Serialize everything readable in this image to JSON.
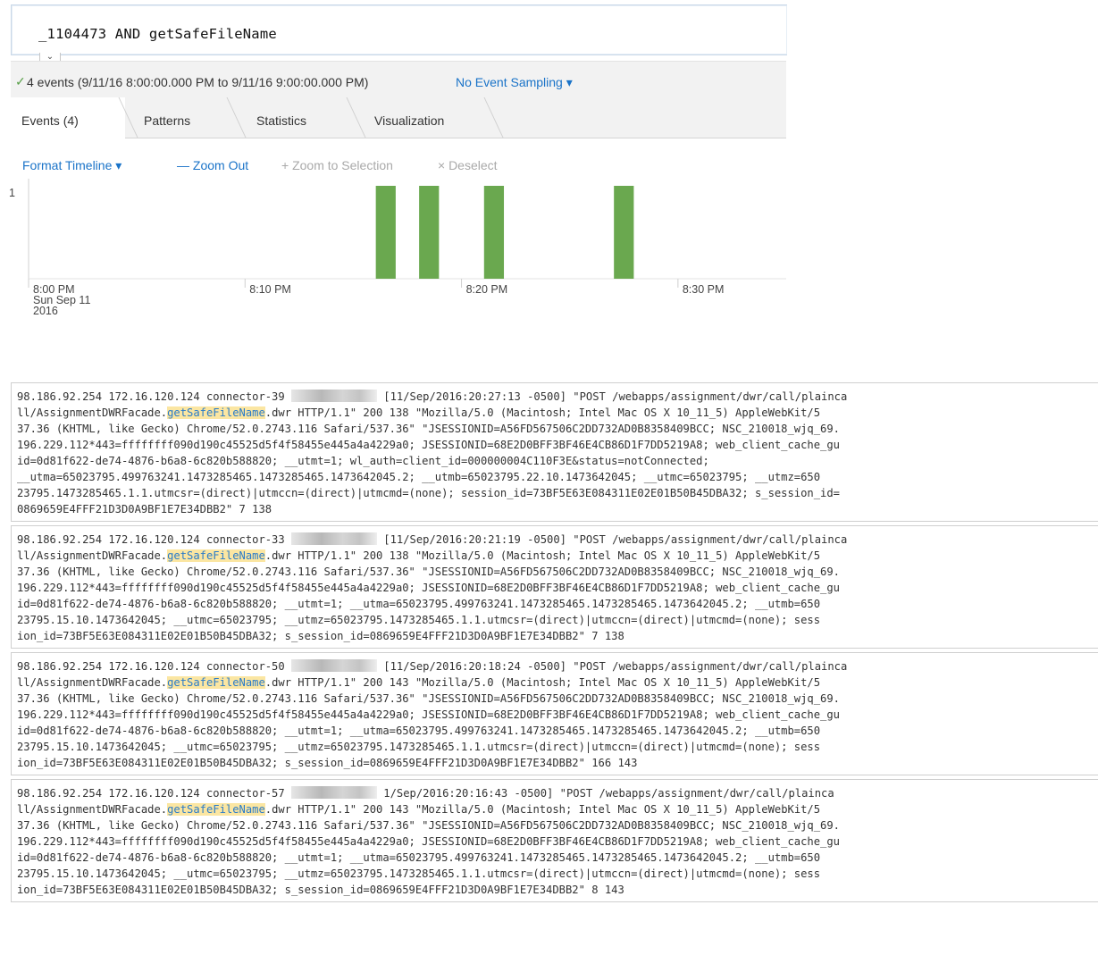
{
  "search": {
    "query": "_1104473 AND getSafeFileName"
  },
  "status": {
    "check_icon": "check-icon",
    "summary": "4 events (9/11/16 8:00:00.000 PM to 9/11/16 9:00:00.000 PM)",
    "sampling": "No Event Sampling ▾"
  },
  "tabs": [
    {
      "label": "Events (4)",
      "active": true
    },
    {
      "label": "Patterns",
      "active": false
    },
    {
      "label": "Statistics",
      "active": false
    },
    {
      "label": "Visualization",
      "active": false
    }
  ],
  "timeline_toolbar": {
    "format": "Format Timeline ▾",
    "zoom_out": "— Zoom Out",
    "zoom_selection": "+ Zoom to Selection",
    "deselect": "× Deselect"
  },
  "chart_data": {
    "type": "bar",
    "y_tick": "1",
    "ylim": [
      0,
      1
    ],
    "xlim_minutes": [
      0,
      35
    ],
    "x_ticks": [
      {
        "minute": 0,
        "line1": "8:00 PM",
        "line2": "Sun Sep 11",
        "line3": "2016"
      },
      {
        "minute": 10,
        "line1": "8:10 PM",
        "line2": "",
        "line3": ""
      },
      {
        "minute": 20,
        "line1": "8:20 PM",
        "line2": "",
        "line3": ""
      },
      {
        "minute": 30,
        "line1": "8:30 PM",
        "line2": "",
        "line3": ""
      }
    ],
    "bars": [
      {
        "minute": 16,
        "count": 1
      },
      {
        "minute": 18,
        "count": 1
      },
      {
        "minute": 21,
        "count": 1
      },
      {
        "minute": 27,
        "count": 1
      }
    ],
    "bar_color": "#6aa84f"
  },
  "events": [
    {
      "lines": [
        [
          "98.186.92.254 172.16.120.124 connector-39 ",
          "[BLUR]",
          " [11/Sep/2016:20:27:13 -0500] \"POST /webapps/assignment/dwr/call/plainca"
        ],
        [
          "ll/AssignmentDWRFacade.",
          "[HL]getSafeFileName",
          ".dwr HTTP/1.1\" 200 138 \"Mozilla/5.0 (Macintosh; Intel Mac OS X 10_11_5) AppleWebKit/5"
        ],
        [
          "37.36 (KHTML, like Gecko) Chrome/52.0.2743.116 Safari/537.36\" \"JSESSIONID=A56FD567506C2DD732AD0B8358409BCC; NSC_210018_wjq_69."
        ],
        [
          "196.229.112*443=ffffffff090d190c45525d5f4f58455e445a4a4229a0; JSESSIONID=68E2D0BFF3BF46E4CB86D1F7DD5219A8; web_client_cache_gu"
        ],
        [
          "id=0d81f622-de74-4876-b6a8-6c820b588820; __utmt=1; wl_auth=client_id=000000004C110F3E&status=notConnected;"
        ],
        [
          "__utma=65023795.499763241.1473285465.1473285465.1473642045.2; __utmb=65023795.22.10.1473642045; __utmc=65023795; __utmz=650"
        ],
        [
          "23795.1473285465.1.1.utmcsr=(direct)|utmccn=(direct)|utmcmd=(none); session_id=73BF5E63E084311E02E01B50B45DBA32; s_session_id="
        ],
        [
          "0869659E4FFF21D3D0A9BF1E7E34DBB2\" 7 138"
        ]
      ]
    },
    {
      "lines": [
        [
          "98.186.92.254 172.16.120.124 connector-33 ",
          "[BLUR]",
          " [11/Sep/2016:20:21:19 -0500] \"POST /webapps/assignment/dwr/call/plainca"
        ],
        [
          "ll/AssignmentDWRFacade.",
          "[HL]getSafeFileName",
          ".dwr HTTP/1.1\" 200 138 \"Mozilla/5.0 (Macintosh; Intel Mac OS X 10_11_5) AppleWebKit/5"
        ],
        [
          "37.36 (KHTML, like Gecko) Chrome/52.0.2743.116 Safari/537.36\" \"JSESSIONID=A56FD567506C2DD732AD0B8358409BCC; NSC_210018_wjq_69."
        ],
        [
          "196.229.112*443=ffffffff090d190c45525d5f4f58455e445a4a4229a0; JSESSIONID=68E2D0BFF3BF46E4CB86D1F7DD5219A8; web_client_cache_gu"
        ],
        [
          "id=0d81f622-de74-4876-b6a8-6c820b588820; __utmt=1; __utma=65023795.499763241.1473285465.1473285465.1473642045.2; __utmb=650"
        ],
        [
          "23795.15.10.1473642045; __utmc=65023795; __utmz=65023795.1473285465.1.1.utmcsr=(direct)|utmccn=(direct)|utmcmd=(none); sess"
        ],
        [
          "ion_id=73BF5E63E084311E02E01B50B45DBA32; s_session_id=0869659E4FFF21D3D0A9BF1E7E34DBB2\" 7 138"
        ]
      ]
    },
    {
      "lines": [
        [
          "98.186.92.254 172.16.120.124 connector-50 ",
          "[BLUR]",
          " [11/Sep/2016:20:18:24 -0500] \"POST /webapps/assignment/dwr/call/plainca"
        ],
        [
          "ll/AssignmentDWRFacade.",
          "[HL]getSafeFileName",
          ".dwr HTTP/1.1\" 200 143 \"Mozilla/5.0 (Macintosh; Intel Mac OS X 10_11_5) AppleWebKit/5"
        ],
        [
          "37.36 (KHTML, like Gecko) Chrome/52.0.2743.116 Safari/537.36\" \"JSESSIONID=A56FD567506C2DD732AD0B8358409BCC; NSC_210018_wjq_69."
        ],
        [
          "196.229.112*443=ffffffff090d190c45525d5f4f58455e445a4a4229a0; JSESSIONID=68E2D0BFF3BF46E4CB86D1F7DD5219A8; web_client_cache_gu"
        ],
        [
          "id=0d81f622-de74-4876-b6a8-6c820b588820; __utmt=1; __utma=65023795.499763241.1473285465.1473285465.1473642045.2; __utmb=650"
        ],
        [
          "23795.15.10.1473642045; __utmc=65023795; __utmz=65023795.1473285465.1.1.utmcsr=(direct)|utmccn=(direct)|utmcmd=(none); sess"
        ],
        [
          "ion_id=73BF5E63E084311E02E01B50B45DBA32; s_session_id=0869659E4FFF21D3D0A9BF1E7E34DBB2\" 166 143"
        ]
      ]
    },
    {
      "lines": [
        [
          "98.186.92.254 172.16.120.124 connector-57 ",
          "[BLUR]",
          " 1/Sep/2016:20:16:43 -0500] \"POST /webapps/assignment/dwr/call/plainca"
        ],
        [
          "ll/AssignmentDWRFacade.",
          "[HL]getSafeFileName",
          ".dwr HTTP/1.1\" 200 143 \"Mozilla/5.0 (Macintosh; Intel Mac OS X 10_11_5) AppleWebKit/5"
        ],
        [
          "37.36 (KHTML, like Gecko) Chrome/52.0.2743.116 Safari/537.36\" \"JSESSIONID=A56FD567506C2DD732AD0B8358409BCC; NSC_210018_wjq_69."
        ],
        [
          "196.229.112*443=ffffffff090d190c45525d5f4f58455e445a4a4229a0; JSESSIONID=68E2D0BFF3BF46E4CB86D1F7DD5219A8; web_client_cache_gu"
        ],
        [
          "id=0d81f622-de74-4876-b6a8-6c820b588820; __utmt=1; __utma=65023795.499763241.1473285465.1473285465.1473642045.2; __utmb=650"
        ],
        [
          "23795.15.10.1473642045; __utmc=65023795; __utmz=65023795.1473285465.1.1.utmcsr=(direct)|utmccn=(direct)|utmcmd=(none); sess"
        ],
        [
          "ion_id=73BF5E63E084311E02E01B50B45DBA32; s_session_id=0869659E4FFF21D3D0A9BF1E7E34DBB2\" 8 143"
        ]
      ]
    }
  ]
}
